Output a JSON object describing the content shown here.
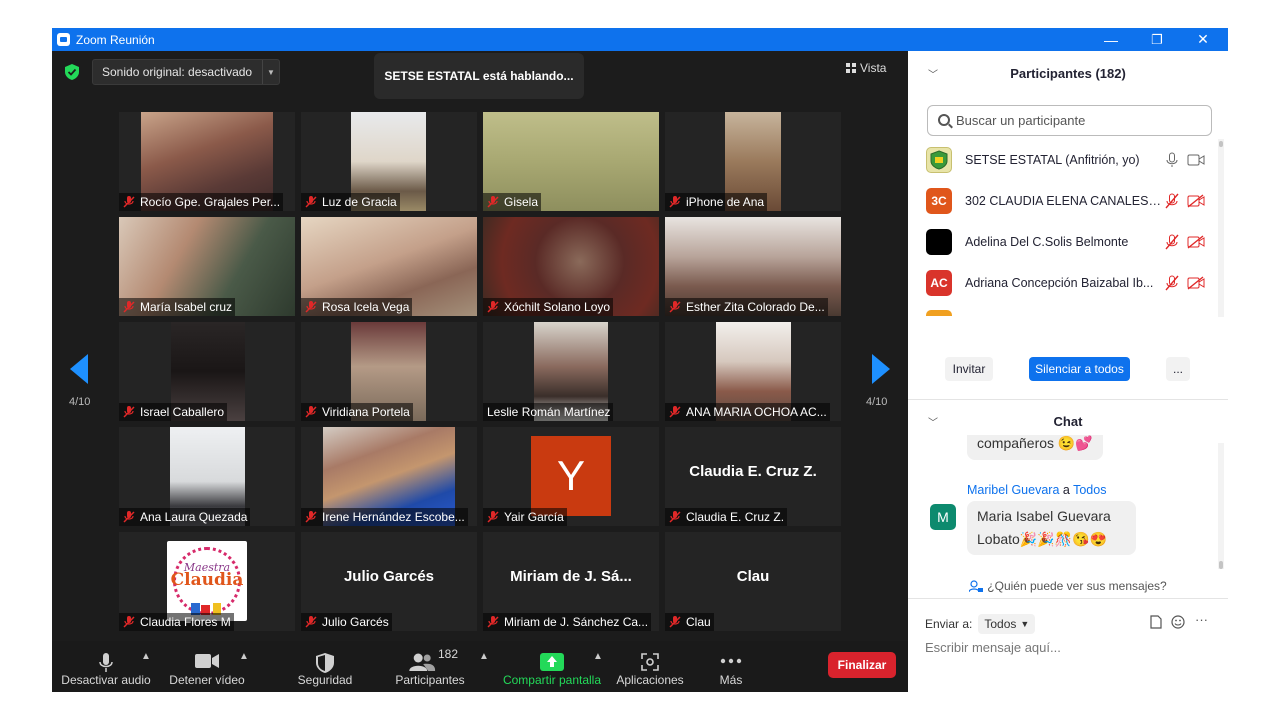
{
  "window": {
    "title": "Zoom Reunión",
    "minimize": "—",
    "restore": "❐",
    "close": "✕"
  },
  "top": {
    "sound_label": "Sonido original: desactivado",
    "speaking_label": "SETSE ESTATAL está hablando...",
    "view_label": "Vista"
  },
  "pager": {
    "left": "4/10",
    "right": "4/10"
  },
  "tiles": [
    {
      "name": "Rocío  Gpe. Grajales Per...",
      "muted": true
    },
    {
      "name": "Luz de Gracia",
      "muted": true
    },
    {
      "name": "Gisela",
      "muted": true
    },
    {
      "name": "iPhone de Ana",
      "muted": true
    },
    {
      "name": "María Isabel cruz",
      "muted": true
    },
    {
      "name": "Rosa Icela Vega",
      "muted": true
    },
    {
      "name": "Xóchilt Solano Loyo",
      "muted": true
    },
    {
      "name": "Esther Zita Colorado De...",
      "muted": true
    },
    {
      "name": "Israel Caballero",
      "muted": true
    },
    {
      "name": "Viridiana Portela",
      "muted": true
    },
    {
      "name": "Leslie Román Martínez",
      "muted": false
    },
    {
      "name": "ANA MARIA OCHOA AC...",
      "muted": true
    },
    {
      "name": "Ana Laura Quezada",
      "muted": true
    },
    {
      "name": "Irene Hernández Escobe...",
      "muted": true
    },
    {
      "name": "Yair García",
      "muted": true,
      "initial": "Y"
    },
    {
      "name": "Claudia E. Cruz Z.",
      "muted": true,
      "display": "Claudia E. Cruz Z."
    },
    {
      "name": "Claudia Flores M",
      "muted": true,
      "logo_text": "Maestra Claudia"
    },
    {
      "name": "Julio Garcés",
      "muted": true,
      "display": "Julio Garcés"
    },
    {
      "name": "Miriam de J. Sánchez Ca...",
      "muted": true,
      "display": "Miriam de J. Sá..."
    },
    {
      "name": "Clau",
      "muted": true,
      "display": "Clau"
    }
  ],
  "toolbar": {
    "audio": "Desactivar audio",
    "video": "Detener vídeo",
    "security": "Seguridad",
    "participants": "Participantes",
    "participants_count": "182",
    "share": "Compartir pantalla",
    "apps": "Aplicaciones",
    "more": "Más",
    "end": "Finalizar"
  },
  "participants_panel": {
    "title": "Participantes (182)",
    "search_placeholder": "Buscar un participante",
    "list": [
      {
        "initials": "",
        "name": "SETSE ESTATAL (Anfitrión, yo)",
        "color": "#e8e4a8",
        "muted": false
      },
      {
        "initials": "3C",
        "name": "302 CLAUDIA ELENA CANALES ...",
        "color": "#e0561b",
        "muted": true
      },
      {
        "initials": "",
        "name": "Adelina Del C.Solis Belmonte",
        "color": "#000000",
        "muted": true
      },
      {
        "initials": "AC",
        "name": "Adriana Concepción Baizabal Ib...",
        "color": "#d9342b",
        "muted": true
      }
    ],
    "invite": "Invitar",
    "mute_all": "Silenciar a todos",
    "more": "..."
  },
  "chat": {
    "title": "Chat",
    "prev_message": "compañeros 😉💕",
    "sender": "Maribel Guevara",
    "sender_to": "a",
    "recipient": "Todos",
    "sender_initial": "M",
    "message": "Maria Isabel Guevara Lobato🎉🎉🎊😘😍",
    "who_can_see": "¿Quién puede ver sus mensajes?",
    "send_to_label": "Enviar a:",
    "send_to_value": "Todos",
    "input_placeholder": "Escribir mensaje aquí...",
    "more": "···"
  },
  "colors": {
    "accent": "#0e72ed",
    "end": "#d9232d",
    "share": "#23d959",
    "chat_avatar": "#0d8a6e"
  }
}
